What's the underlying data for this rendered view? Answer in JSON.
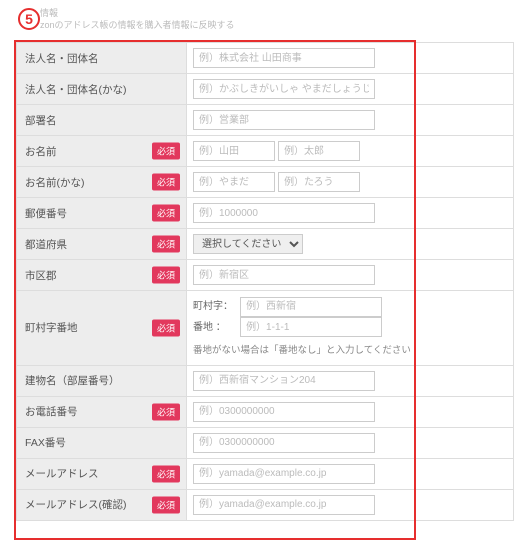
{
  "circle_number": "5",
  "header": {
    "line1": "情報",
    "line2": "zonのアドレス帳の情報を購入者情報に反映する"
  },
  "labels": {
    "required": "必須",
    "company": "法人名・団体名",
    "company_kana": "法人名・団体名(かな)",
    "department": "部署名",
    "name": "お名前",
    "name_kana": "お名前(かな)",
    "postal": "郵便番号",
    "prefecture": "都道府県",
    "city": "市区郡",
    "town_block": "町村字番地",
    "town_label": "町村字：",
    "block_label": "番地 ：",
    "town_hint": "番地がない場合は「番地なし」と入力してください",
    "building": "建物名（部屋番号）",
    "phone": "お電話番号",
    "fax": "FAX番号",
    "email": "メールアドレス",
    "email_confirm": "メールアドレス(確認)"
  },
  "placeholders": {
    "company": "例）株式会社 山田商事",
    "company_kana": "例）かぶしきがいしゃ やまだしょうじ",
    "department": "例）営業部",
    "name_last": "例）山田",
    "name_first": "例）太郎",
    "name_kana_last": "例）やまだ",
    "name_kana_first": "例）たろう",
    "postal": "例）1000000",
    "pref_option": "選択してください",
    "city": "例）新宿区",
    "town": "例）西新宿",
    "block": "例）1-1-1",
    "building": "例）西新宿マンション204",
    "phone": "例）0300000000",
    "fax": "例）0300000000",
    "email": "例）yamada@example.co.jp",
    "email_confirm": "例）yamada@example.co.jp"
  }
}
